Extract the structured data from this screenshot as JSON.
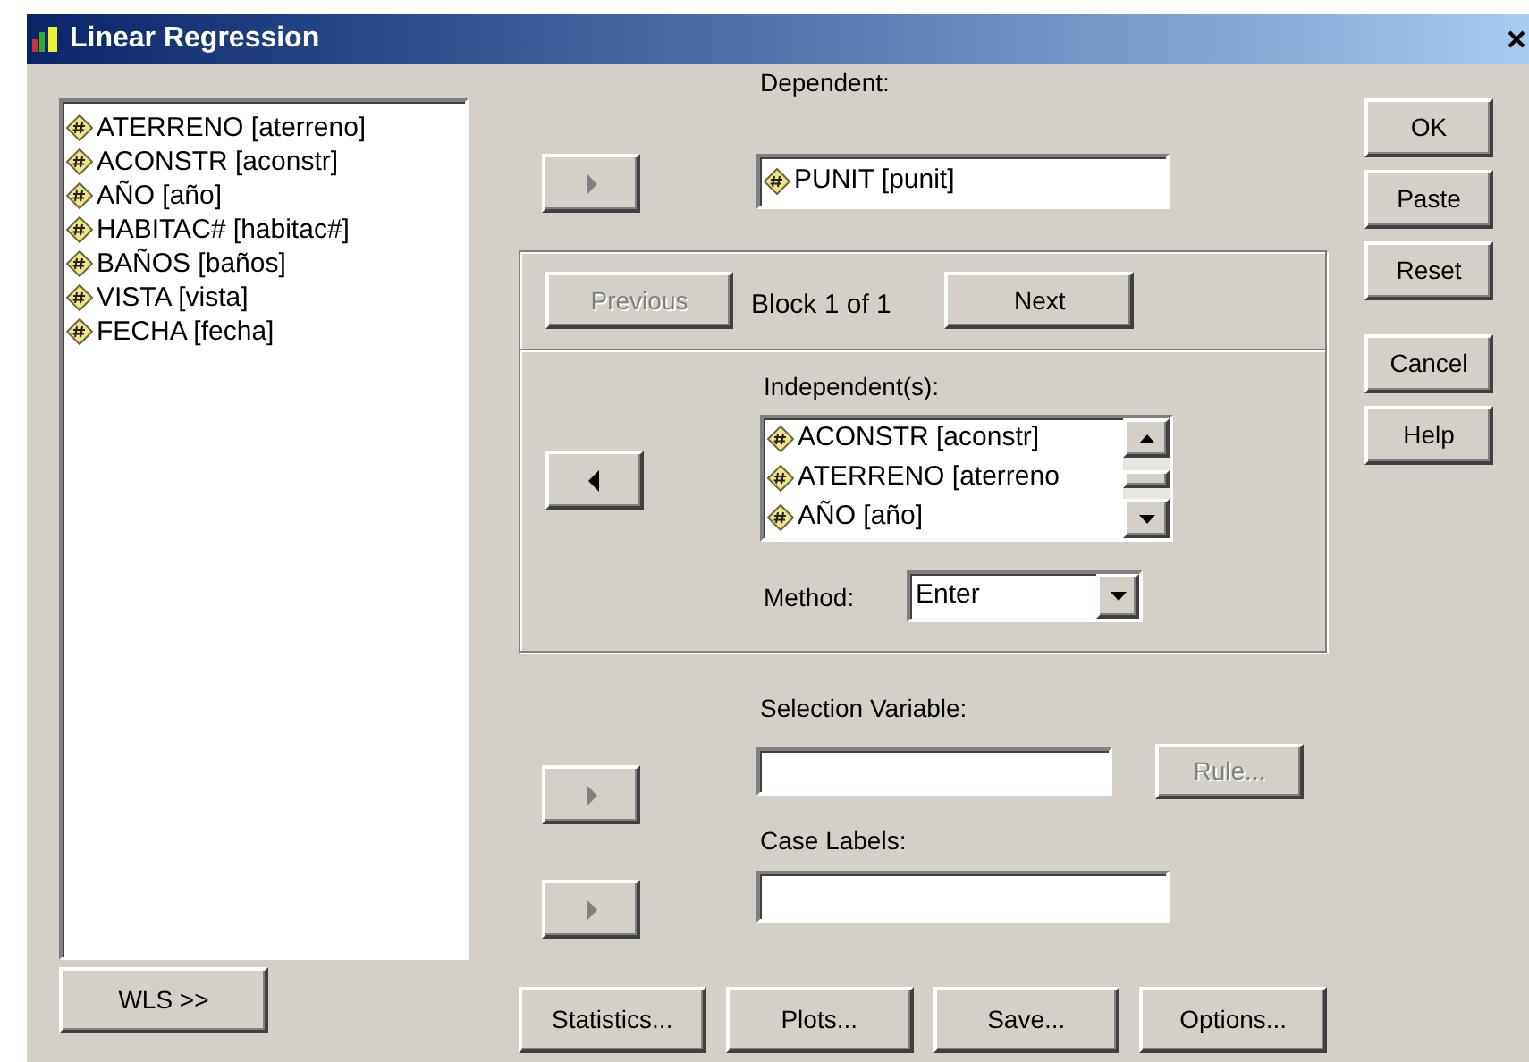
{
  "window": {
    "title": "Linear Regression"
  },
  "variables": [
    "ATERRENO [aterreno]",
    "ACONSTR [aconstr]",
    "AÑO [año]",
    "HABITAC# [habitac#]",
    "BAÑOS [baños]",
    "VISTA [vista]",
    "FECHA [fecha]"
  ],
  "wls_button": "WLS >>",
  "move_buttons": [
    {
      "kind": "right",
      "disabled": true
    },
    {
      "kind": "left",
      "disabled": false
    },
    {
      "kind": "right",
      "disabled": true
    },
    {
      "kind": "right",
      "disabled": true
    }
  ],
  "dependent": {
    "label": "Dependent:",
    "value": "PUNIT [punit]"
  },
  "block": {
    "previous": {
      "label": "Previous",
      "disabled": true
    },
    "status": "Block 1 of 1",
    "next": {
      "label": "Next",
      "disabled": false
    }
  },
  "independents": {
    "label": "Independent(s):",
    "items": [
      "ACONSTR [aconstr]",
      "ATERRENO [aterreno",
      "AÑO [año]"
    ]
  },
  "method": {
    "label": "Method:",
    "value": "Enter"
  },
  "selection_variable": {
    "label": "Selection Variable:"
  },
  "rule_button": {
    "label": "Rule...",
    "disabled": true
  },
  "case_labels": {
    "label": "Case Labels:"
  },
  "action_buttons": [
    "OK",
    "Paste",
    "Reset",
    "Cancel",
    "Help"
  ],
  "bottom_buttons": [
    "Statistics...",
    "Plots...",
    "Save...",
    "Options..."
  ]
}
